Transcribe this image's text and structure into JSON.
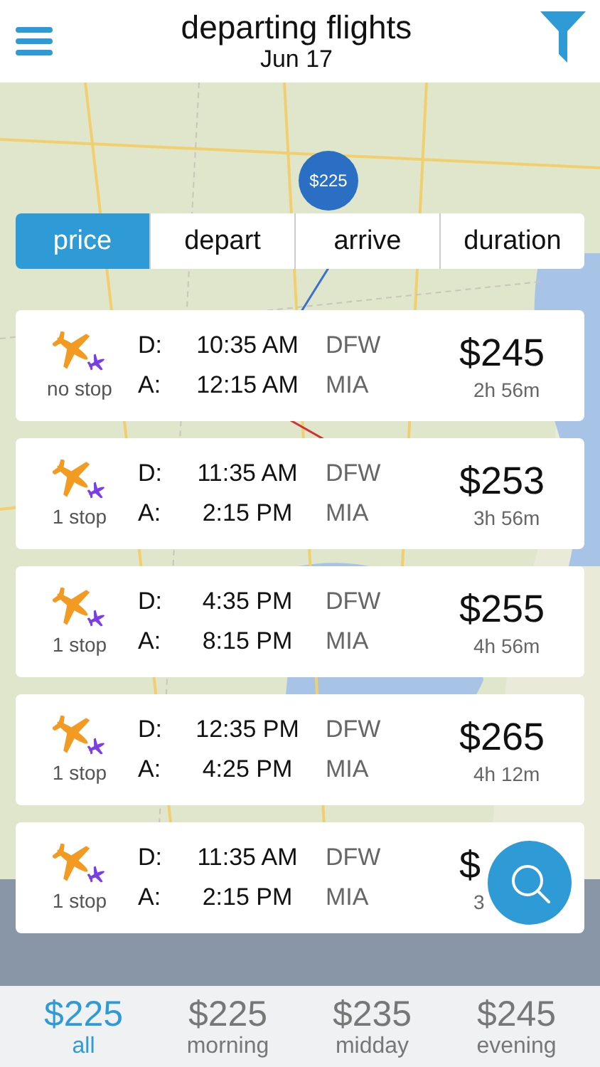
{
  "header": {
    "title": "departing flights",
    "date": "Jun 17"
  },
  "map_marker": {
    "price": "$225"
  },
  "sort_tabs": [
    {
      "label": "price",
      "selected": true
    },
    {
      "label": "depart",
      "selected": false
    },
    {
      "label": "arrive",
      "selected": false
    },
    {
      "label": "duration",
      "selected": false
    }
  ],
  "flights": [
    {
      "stops": "no stop",
      "depart_label": "D:",
      "depart_time": "10:35 AM",
      "depart_airport": "DFW",
      "arrive_label": "A:",
      "arrive_time": "12:15 AM",
      "arrive_airport": "MIA",
      "price": "$245",
      "duration": "2h 56m"
    },
    {
      "stops": "1 stop",
      "depart_label": "D:",
      "depart_time": "11:35 AM",
      "depart_airport": "DFW",
      "arrive_label": "A:",
      "arrive_time": "2:15 PM",
      "arrive_airport": "MIA",
      "price": "$253",
      "duration": "3h 56m"
    },
    {
      "stops": "1 stop",
      "depart_label": "D:",
      "depart_time": "4:35 PM",
      "depart_airport": "DFW",
      "arrive_label": "A:",
      "arrive_time": "8:15 PM",
      "arrive_airport": "MIA",
      "price": "$255",
      "duration": "4h 56m"
    },
    {
      "stops": "1 stop",
      "depart_label": "D:",
      "depart_time": "12:35 PM",
      "depart_airport": "DFW",
      "arrive_label": "A:",
      "arrive_time": "4:25 PM",
      "arrive_airport": "MIA",
      "price": "$265",
      "duration": "4h 12m"
    },
    {
      "stops": "1 stop",
      "depart_label": "D:",
      "depart_time": "11:35 AM",
      "depart_airport": "DFW",
      "arrive_label": "A:",
      "arrive_time": "2:15 PM",
      "arrive_airport": "MIA",
      "price": "$",
      "duration": "3"
    }
  ],
  "time_filters": [
    {
      "price": "$225",
      "label": "all",
      "selected": true
    },
    {
      "price": "$225",
      "label": "morning",
      "selected": false
    },
    {
      "price": "$235",
      "label": "midday",
      "selected": false
    },
    {
      "price": "$245",
      "label": "evening",
      "selected": false
    }
  ]
}
